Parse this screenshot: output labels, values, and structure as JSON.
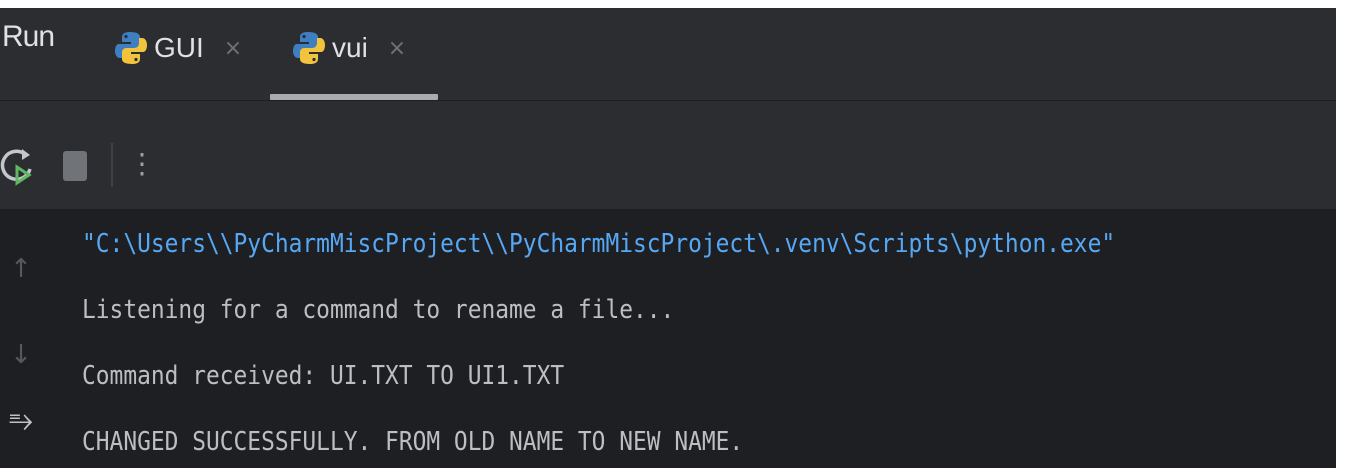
{
  "run_panel": {
    "title": "Run",
    "tabs": [
      {
        "label": "GUI",
        "icon": "python-icon",
        "close": "×",
        "active": false
      },
      {
        "label": "vui",
        "icon": "python-icon",
        "close": "×",
        "active": true
      }
    ]
  },
  "toolbar": {
    "rerun_icon": "rerun-icon",
    "stop_icon": "stop-icon",
    "more_icon": "more-vertical-icon",
    "more_glyph": "⋮"
  },
  "gutter": {
    "up_glyph": "↑",
    "down_glyph": "↓",
    "wrap_glyph": "⥱",
    "icons": [
      "arrow-up-icon",
      "arrow-down-icon",
      "soft-wrap-icon"
    ]
  },
  "console": {
    "lines": [
      "\"C:\\Users\\\\PyCharmMiscProject\\\\PyCharmMiscProject\\.venv\\Scripts\\python.exe\"",
      "Listening for a command to rename a file...",
      "Command received: UI.TXT TO UI1.TXT",
      "CHANGED SUCCESSFULLY. FROM OLD NAME TO NEW NAME."
    ]
  },
  "colors": {
    "panel_bg": "#2b2d30",
    "console_bg": "#1e1f22",
    "command_line": "#56a8f5",
    "text": "#bcbec4",
    "python_blue": "#3d7fc1",
    "python_yellow": "#f2c43d",
    "rerun_green": "#5fb85f"
  }
}
